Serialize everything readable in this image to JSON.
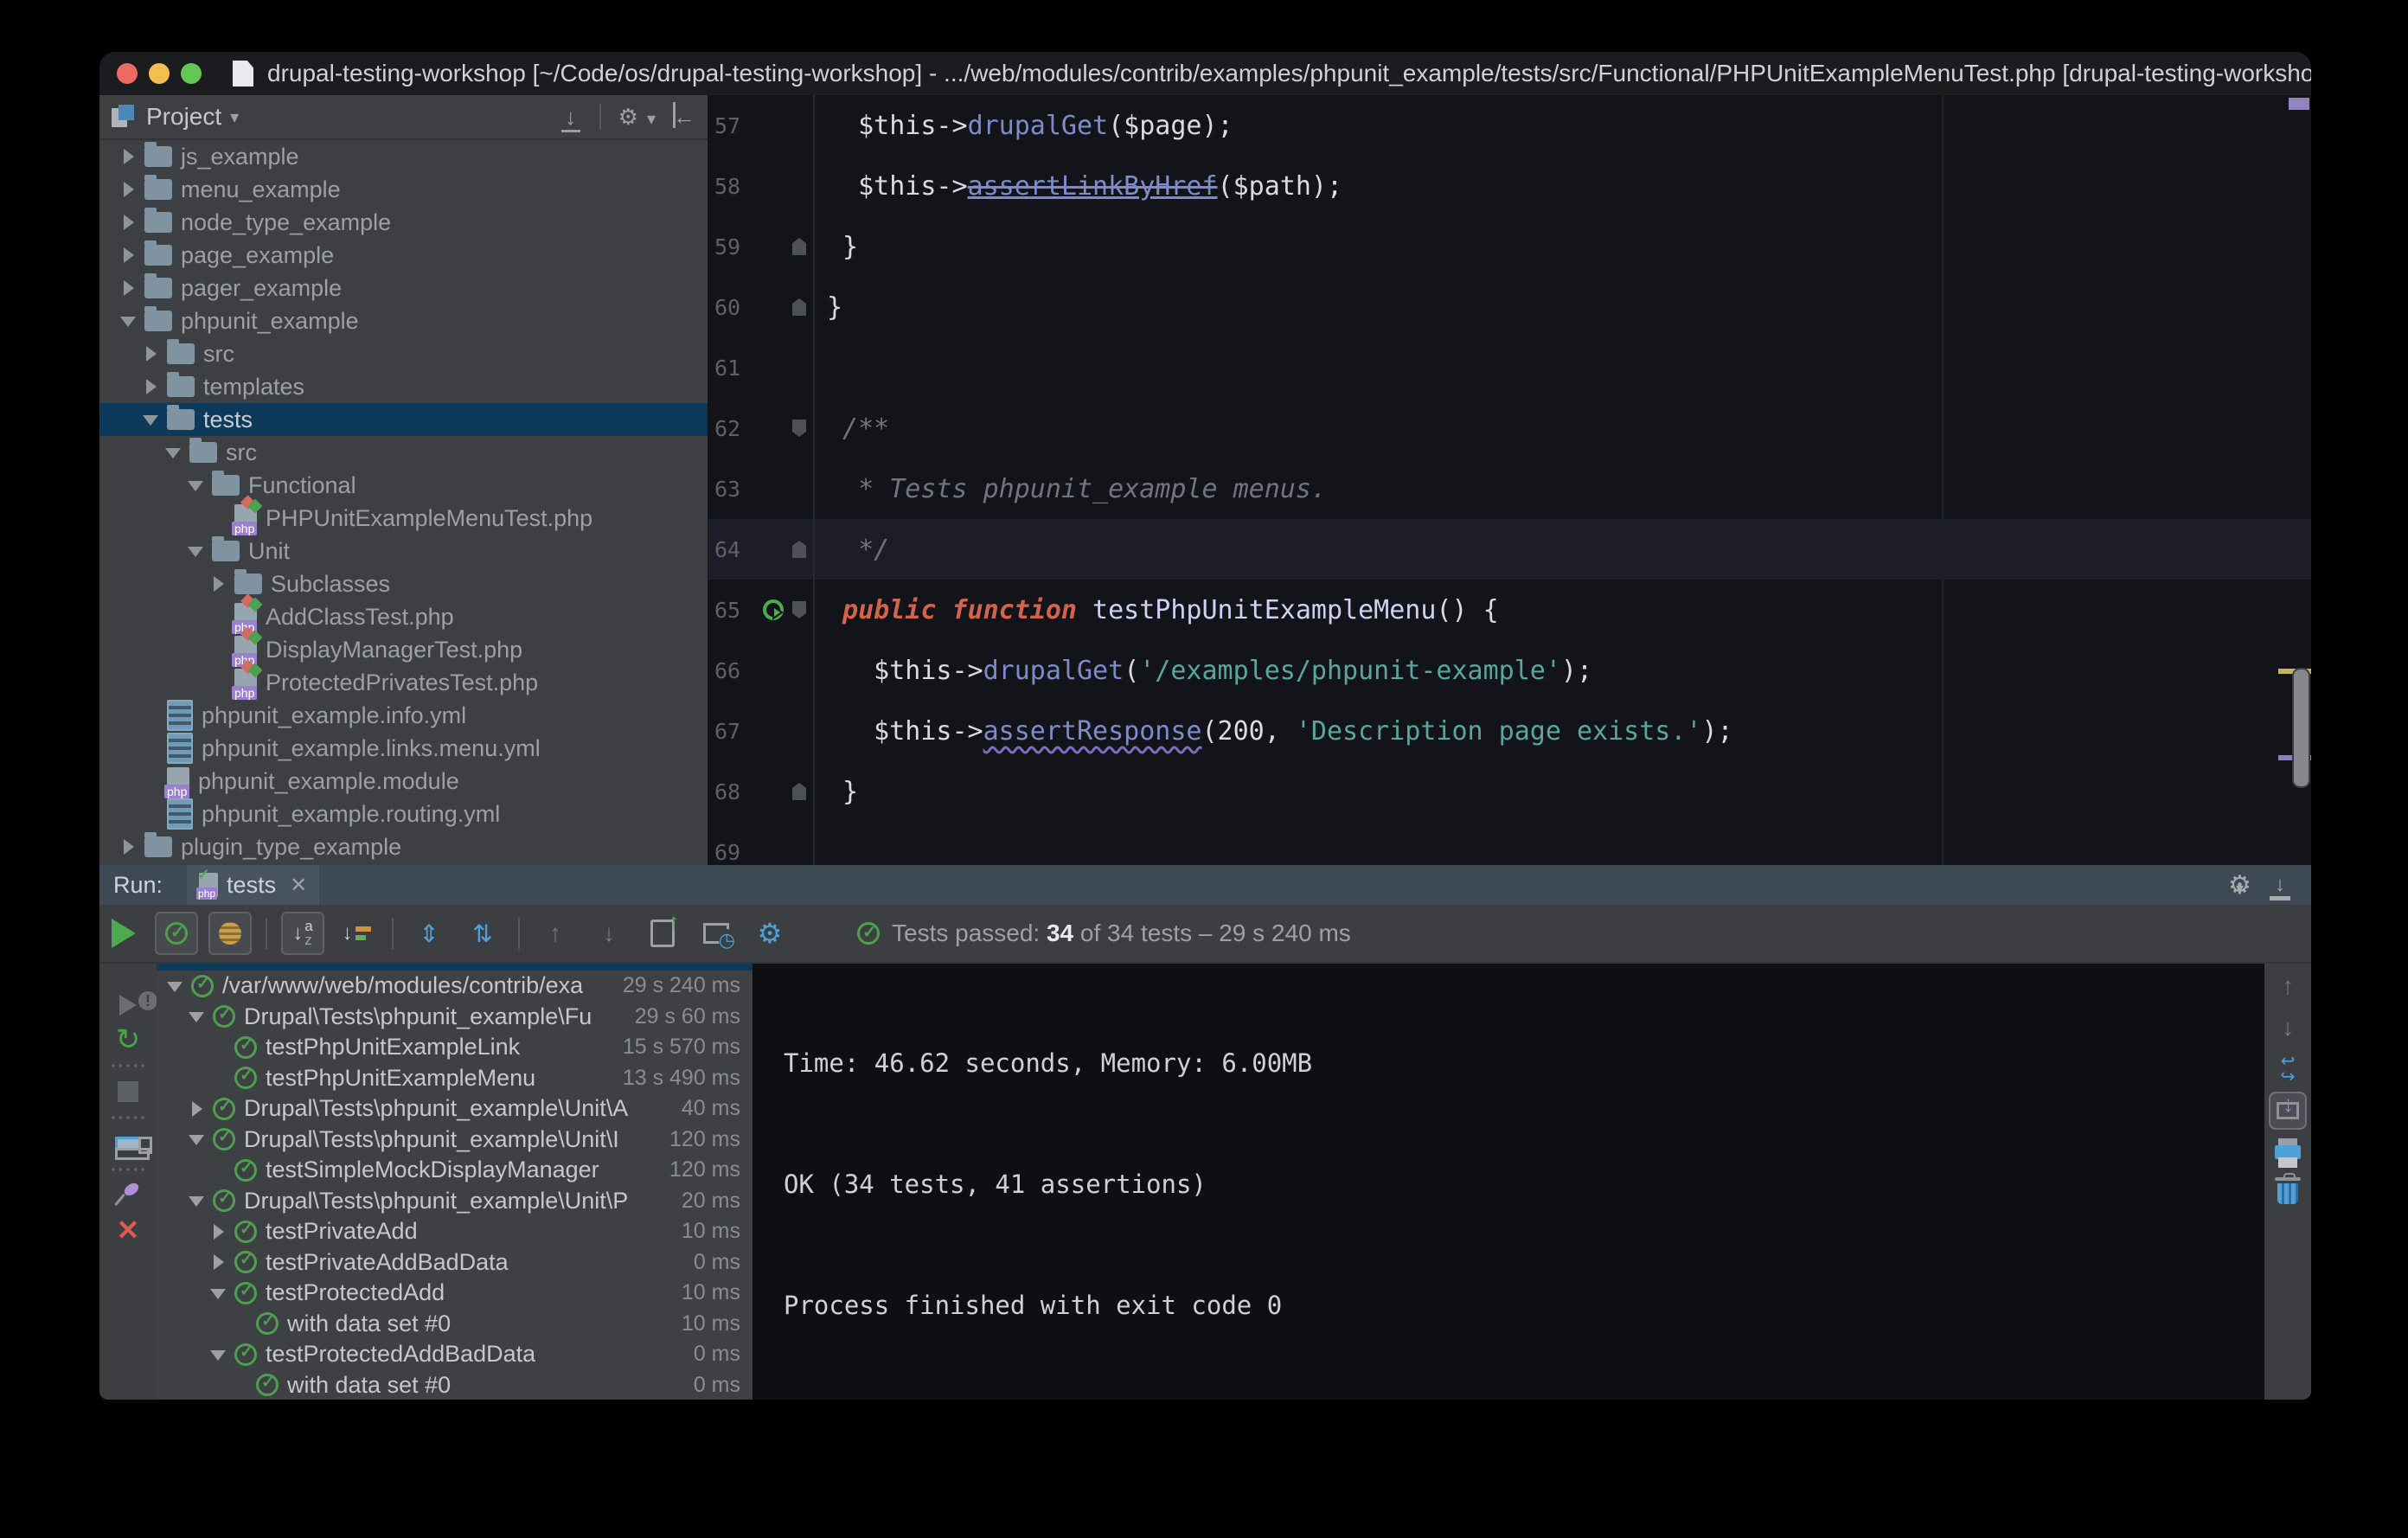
{
  "window": {
    "title": "drupal-testing-workshop [~/Code/os/drupal-testing-workshop] - .../web/modules/contrib/examples/phpunit_example/tests/src/Functional/PHPUnitExampleMenuTest.php [drupal-testing-workshop]"
  },
  "colors": {
    "traffic_close": "#ec6a5e",
    "traffic_min": "#f5bf4f",
    "traffic_zoom": "#62c554",
    "selection": "#0d3a5a",
    "pass_green": "#4f9e4f",
    "error_red": "#e15a51",
    "keyword": "#d3634a",
    "string": "#57a79e",
    "method": "#7d8cc9",
    "comment": "#6f757c"
  },
  "glyphs": {
    "project_caret": "▾",
    "collapse_all": "↓",
    "gear": "⚙",
    "gear_caret": "▾",
    "hide_panel": "←",
    "tab_close": "✕",
    "minimize_arrow": "↓",
    "expand_all": "⇕",
    "collapse_tree": "⇅",
    "nav_up": "↑",
    "nav_down": "↓",
    "sort_arrow": "↓",
    "az_a": "a",
    "az_z": "z",
    "rerun": "↻",
    "scroll_up": "↑",
    "scroll_down": "↓",
    "wrap_top": "↩",
    "wrap_bottom": "↪"
  },
  "project_panel": {
    "title": "Project",
    "tree": [
      {
        "label": "js_example",
        "lvl": 0,
        "icon": "folder",
        "arrow": "col",
        "sel": false
      },
      {
        "label": "menu_example",
        "lvl": 0,
        "icon": "folder",
        "arrow": "col",
        "sel": false
      },
      {
        "label": "node_type_example",
        "lvl": 0,
        "icon": "folder",
        "arrow": "col",
        "sel": false
      },
      {
        "label": "page_example",
        "lvl": 0,
        "icon": "folder",
        "arrow": "col",
        "sel": false
      },
      {
        "label": "pager_example",
        "lvl": 0,
        "icon": "folder",
        "arrow": "col",
        "sel": false
      },
      {
        "label": "phpunit_example",
        "lvl": 0,
        "icon": "folder",
        "arrow": "exp",
        "sel": false
      },
      {
        "label": "src",
        "lvl": 1,
        "icon": "folder",
        "arrow": "col",
        "sel": false
      },
      {
        "label": "templates",
        "lvl": 1,
        "icon": "folder",
        "arrow": "col",
        "sel": false
      },
      {
        "label": "tests",
        "lvl": 1,
        "icon": "folder",
        "arrow": "exp",
        "sel": true
      },
      {
        "label": "src",
        "lvl": 2,
        "icon": "folder",
        "arrow": "exp",
        "sel": false
      },
      {
        "label": "Functional",
        "lvl": 3,
        "icon": "folder",
        "arrow": "exp",
        "sel": false
      },
      {
        "label": "PHPUnitExampleMenuTest.php",
        "lvl": 4,
        "icon": "php-test",
        "arrow": "none",
        "sel": false
      },
      {
        "label": "Unit",
        "lvl": 3,
        "icon": "folder",
        "arrow": "exp",
        "sel": false
      },
      {
        "label": "Subclasses",
        "lvl": 4,
        "icon": "folder",
        "arrow": "col",
        "sel": false
      },
      {
        "label": "AddClassTest.php",
        "lvl": 4,
        "icon": "php-test",
        "arrow": "none",
        "sel": false
      },
      {
        "label": "DisplayManagerTest.php",
        "lvl": 4,
        "icon": "php-test",
        "arrow": "none",
        "sel": false
      },
      {
        "label": "ProtectedPrivatesTest.php",
        "lvl": 4,
        "icon": "php-test",
        "arrow": "none",
        "sel": false
      },
      {
        "label": "phpunit_example.info.yml",
        "lvl": 1,
        "icon": "yml",
        "arrow": "none",
        "sel": false
      },
      {
        "label": "phpunit_example.links.menu.yml",
        "lvl": 1,
        "icon": "yml",
        "arrow": "none",
        "sel": false
      },
      {
        "label": "phpunit_example.module",
        "lvl": 1,
        "icon": "php",
        "arrow": "none",
        "sel": false
      },
      {
        "label": "phpunit_example.routing.yml",
        "lvl": 1,
        "icon": "yml",
        "arrow": "none",
        "sel": false
      },
      {
        "label": "plugin_type_example",
        "lvl": 0,
        "icon": "folder",
        "arrow": "col",
        "sel": false
      }
    ]
  },
  "editor": {
    "lines": [
      {
        "n": "57",
        "g": [],
        "cur": false,
        "tok": [
          {
            "c": "pl",
            "t": "  $this->"
          },
          {
            "c": "mth",
            "t": "drupalGet"
          },
          {
            "c": "pl",
            "t": "($page);"
          }
        ]
      },
      {
        "n": "58",
        "g": [],
        "cur": false,
        "tok": [
          {
            "c": "pl",
            "t": "  $this->"
          },
          {
            "c": "mth strike",
            "t": "assertLinkByHref"
          },
          {
            "c": "pl",
            "t": "($path);"
          }
        ]
      },
      {
        "n": "59",
        "g": [
          "end"
        ],
        "cur": false,
        "tok": [
          {
            "c": "pl",
            "t": " }"
          }
        ]
      },
      {
        "n": "60",
        "g": [
          "end"
        ],
        "cur": false,
        "tok": [
          {
            "c": "pl",
            "t": "}"
          }
        ]
      },
      {
        "n": "61",
        "g": [],
        "cur": false,
        "tok": []
      },
      {
        "n": "62",
        "g": [
          "start"
        ],
        "cur": false,
        "tok": [
          {
            "c": "cm",
            "t": " /**"
          }
        ]
      },
      {
        "n": "63",
        "g": [],
        "cur": false,
        "tok": [
          {
            "c": "cm",
            "t": "  * Tests phpunit_example menus."
          }
        ]
      },
      {
        "n": "64",
        "g": [
          "end"
        ],
        "cur": true,
        "tok": [
          {
            "c": "cm",
            "t": "  */"
          }
        ]
      },
      {
        "n": "65",
        "g": [
          "run",
          "start"
        ],
        "cur": false,
        "tok": [
          {
            "c": "kw",
            "t": " public function "
          },
          {
            "c": "fn",
            "t": "testPhpUnitExampleMenu"
          },
          {
            "c": "pl",
            "t": "() {"
          }
        ]
      },
      {
        "n": "66",
        "g": [],
        "cur": false,
        "tok": [
          {
            "c": "pl",
            "t": "   $this->"
          },
          {
            "c": "mth",
            "t": "drupalGet"
          },
          {
            "c": "pl",
            "t": "("
          },
          {
            "c": "str",
            "t": "'/examples/phpunit-example'"
          },
          {
            "c": "pl",
            "t": ");"
          }
        ]
      },
      {
        "n": "67",
        "g": [],
        "cur": false,
        "tok": [
          {
            "c": "pl",
            "t": "   $this->"
          },
          {
            "c": "mth wavy",
            "t": "assertResponse"
          },
          {
            "c": "pl",
            "t": "(200, "
          },
          {
            "c": "str",
            "t": "'Description page exists.'"
          },
          {
            "c": "pl",
            "t": ");"
          }
        ]
      },
      {
        "n": "68",
        "g": [
          "end"
        ],
        "cur": false,
        "tok": [
          {
            "c": "pl",
            "t": " }"
          }
        ]
      },
      {
        "n": "69",
        "g": [],
        "cur": false,
        "tok": []
      }
    ]
  },
  "run_panel": {
    "label": "Run:",
    "tab": {
      "label": "tests"
    },
    "status": {
      "prefix": "Tests passed:",
      "count": "34",
      "suffix": "of 34 tests – 29 s 240 ms"
    },
    "tests": [
      {
        "label": "/var/www/web/modules/contrib/exa",
        "dur": "29 s 240 ms",
        "lvl": 0,
        "arrow": "exp"
      },
      {
        "label": "Drupal\\Tests\\phpunit_example\\Fu",
        "dur": "29 s 60 ms",
        "lvl": 1,
        "arrow": "exp"
      },
      {
        "label": "testPhpUnitExampleLink",
        "dur": "15 s 570 ms",
        "lvl": 2,
        "arrow": "none"
      },
      {
        "label": "testPhpUnitExampleMenu",
        "dur": "13 s 490 ms",
        "lvl": 2,
        "arrow": "none"
      },
      {
        "label": "Drupal\\Tests\\phpunit_example\\Unit\\A",
        "dur": "40 ms",
        "lvl": 1,
        "arrow": "col"
      },
      {
        "label": "Drupal\\Tests\\phpunit_example\\Unit\\I",
        "dur": "120 ms",
        "lvl": 1,
        "arrow": "exp"
      },
      {
        "label": "testSimpleMockDisplayManager",
        "dur": "120 ms",
        "lvl": 2,
        "arrow": "none"
      },
      {
        "label": "Drupal\\Tests\\phpunit_example\\Unit\\P",
        "dur": "20 ms",
        "lvl": 1,
        "arrow": "exp"
      },
      {
        "label": "testPrivateAdd",
        "dur": "10 ms",
        "lvl": 2,
        "arrow": "col"
      },
      {
        "label": "testPrivateAddBadData",
        "dur": "0 ms",
        "lvl": 2,
        "arrow": "col"
      },
      {
        "label": "testProtectedAdd",
        "dur": "10 ms",
        "lvl": 2,
        "arrow": "exp"
      },
      {
        "label": "with data set #0",
        "dur": "10 ms",
        "lvl": 3,
        "arrow": "none"
      },
      {
        "label": "testProtectedAddBadData",
        "dur": "0 ms",
        "lvl": 2,
        "arrow": "exp"
      },
      {
        "label": "with data set #0",
        "dur": "0 ms",
        "lvl": 3,
        "arrow": "none"
      }
    ],
    "console": {
      "lines": [
        "Time: 46.62 seconds, Memory: 6.00MB",
        "OK (34 tests, 41 assertions)",
        "Process finished with exit code 0"
      ]
    }
  }
}
